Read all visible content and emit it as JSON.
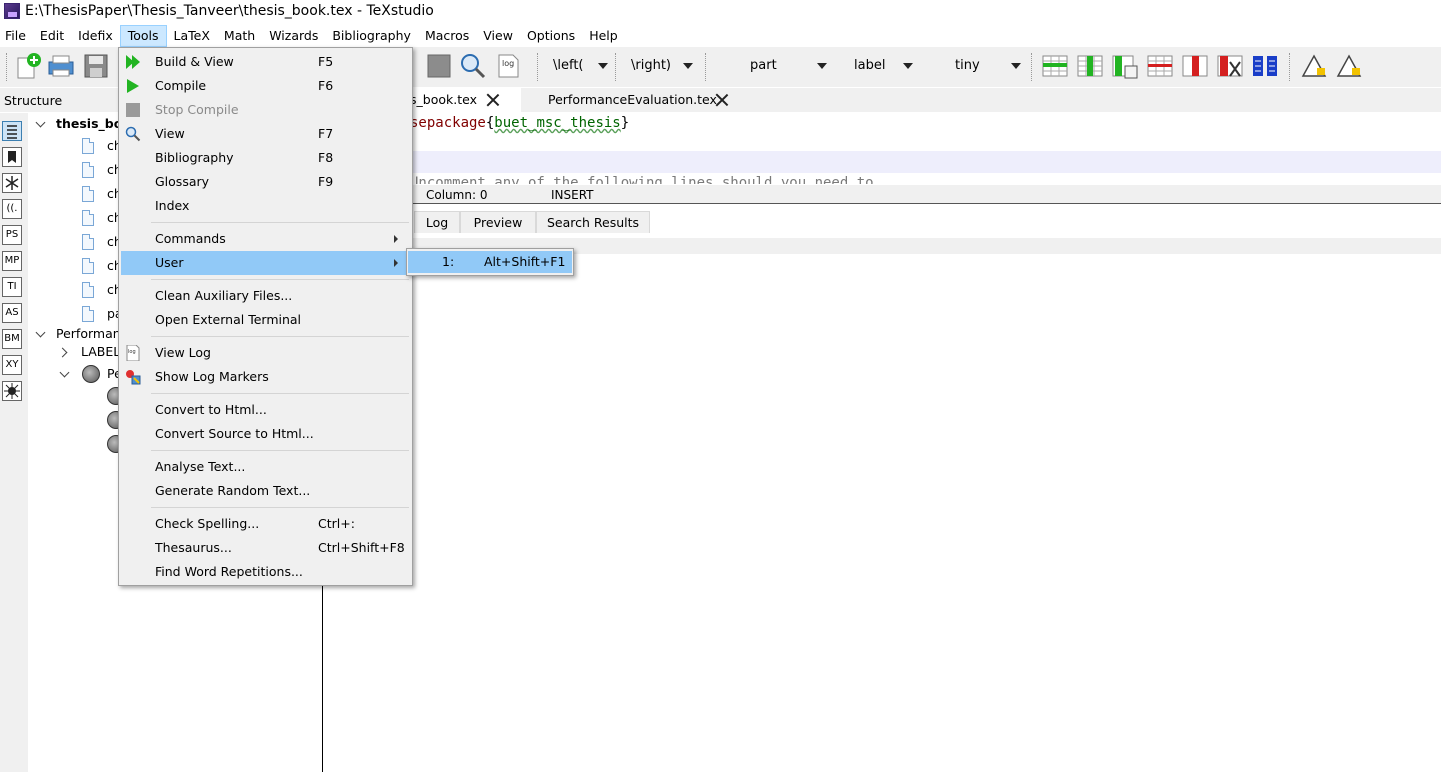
{
  "window": {
    "title": "E:\\ThesisPaper\\Thesis_Tanveer\\thesis_book.tex - TeXstudio"
  },
  "menubar": {
    "items": [
      "File",
      "Edit",
      "Idefix",
      "Tools",
      "LaTeX",
      "Math",
      "Wizards",
      "Bibliography",
      "Macros",
      "View",
      "Options",
      "Help"
    ],
    "active": "Tools"
  },
  "toolbar": {
    "combos": [
      {
        "label": "\\left("
      },
      {
        "label": "\\right)"
      },
      {
        "label": "part"
      },
      {
        "label": "label"
      },
      {
        "label": "tiny"
      }
    ],
    "icons": [
      "new-file-icon",
      "print-icon",
      "save-icon",
      "stop-icon",
      "zoom-icon",
      "log-icon",
      "table-add-row-icon",
      "table-add-column-icon",
      "table-paste-column-icon",
      "table-remove-row-icon",
      "table-remove-column-icon",
      "table-cut-column-icon",
      "table-align-icon",
      "warning-icon",
      "warning-next-icon"
    ],
    "accent_green": "#22b422",
    "accent_red": "#d42020",
    "accent_blue": "#1a3ec8"
  },
  "structure": {
    "title": "Structure",
    "side_buttons": [
      "",
      "",
      "",
      "((.",
      "PS",
      "MP",
      "TI",
      "AS",
      "BM",
      "XY",
      ""
    ],
    "tree": {
      "root": "thesis_bo",
      "files": [
        "ch",
        "ch",
        "ch",
        "ch",
        "ch",
        "ch",
        "ch",
        "pa"
      ],
      "root2": "Performan",
      "labels": "LABELS",
      "sub": "Pe"
    }
  },
  "editor": {
    "tabs": [
      {
        "label": "s_book.tex"
      },
      {
        "label": "PerformanceEvaluation.tex"
      }
    ],
    "code": {
      "line1_cmd": "sepackage",
      "line1_open": "{",
      "line1_arg": "buet_msc_thesis",
      "line1_close": "}",
      "line2": "Uncomment any of the following lines should you need to"
    },
    "status": {
      "column": "Column: 0",
      "mode": "INSERT"
    },
    "output_tabs": [
      "Log",
      "Preview",
      "Search Results"
    ]
  },
  "tools_menu": {
    "items": [
      {
        "label": "Build & View",
        "shortcut": "F5",
        "icon": "build-view-icon"
      },
      {
        "label": "Compile",
        "shortcut": "F6",
        "icon": "compile-icon"
      },
      {
        "label": "Stop Compile",
        "shortcut": "",
        "icon": "stop-compile-icon",
        "disabled": true
      },
      {
        "label": "View",
        "shortcut": "F7",
        "icon": "view-icon"
      },
      {
        "label": "Bibliography",
        "shortcut": "F8"
      },
      {
        "label": "Glossary",
        "shortcut": "F9"
      },
      {
        "label": "Index",
        "shortcut": ""
      },
      {
        "label": "Commands",
        "submenu": true
      },
      {
        "label": "User",
        "submenu": true,
        "highlighted": true
      },
      {
        "label": "Clean Auxiliary Files..."
      },
      {
        "label": "Open External Terminal"
      },
      {
        "label": "View Log",
        "icon": "log-icon"
      },
      {
        "label": "Show Log Markers",
        "icon": "log-markers-icon"
      },
      {
        "label": "Convert to Html..."
      },
      {
        "label": "Convert Source to Html..."
      },
      {
        "label": "Analyse Text..."
      },
      {
        "label": "Generate Random Text..."
      },
      {
        "label": "Check Spelling...",
        "shortcut": "Ctrl+:"
      },
      {
        "label": "Thesaurus...",
        "shortcut": "Ctrl+Shift+F8"
      },
      {
        "label": "Find Word Repetitions..."
      }
    ],
    "highlight_color": "#91c9f7"
  },
  "user_submenu": {
    "items": [
      {
        "label": "1:",
        "shortcut": "Alt+Shift+F1"
      }
    ]
  }
}
